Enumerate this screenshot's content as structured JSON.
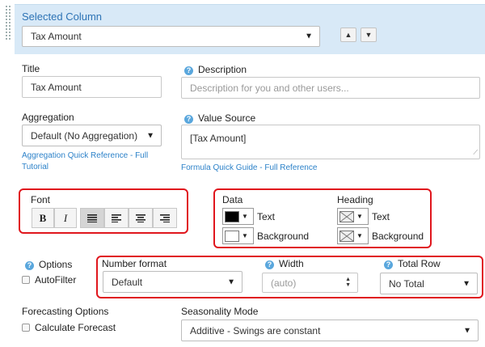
{
  "selected_column": {
    "heading": "Selected Column",
    "value": "Tax Amount"
  },
  "title": {
    "label": "Title",
    "value": "Tax Amount"
  },
  "description": {
    "label": "Description",
    "placeholder": "Description for you and other users..."
  },
  "aggregation": {
    "label": "Aggregation",
    "value": "Default (No Aggregation)",
    "link_line1": "Aggregation Quick Reference - Full",
    "link_line2": "Tutorial"
  },
  "value_source": {
    "label": "Value Source",
    "value": "[Tax Amount]",
    "link": "Formula Quick Guide - Full Reference"
  },
  "font": {
    "label": "Font",
    "bold": "B",
    "italic": "I"
  },
  "data_colors": {
    "label": "Data",
    "text_label": "Text",
    "background_label": "Background",
    "text_color": "#000000",
    "background_color": "#ffffff"
  },
  "heading_colors": {
    "label": "Heading",
    "text_label": "Text",
    "background_label": "Background"
  },
  "options": {
    "label": "Options",
    "autofilter": "AutoFilter"
  },
  "number_format": {
    "label": "Number format",
    "value": "Default"
  },
  "width": {
    "label": "Width",
    "placeholder": "(auto)"
  },
  "total_row": {
    "label": "Total Row",
    "value": "No Total"
  },
  "forecasting": {
    "label": "Forecasting Options",
    "calculate": "Calculate Forecast"
  },
  "seasonality": {
    "label": "Seasonality Mode",
    "value": "Additive - Swings are constant"
  },
  "colors": {
    "accent": "#2d73b5",
    "band": "#d8e9f7",
    "highlight": "#e0161d"
  }
}
